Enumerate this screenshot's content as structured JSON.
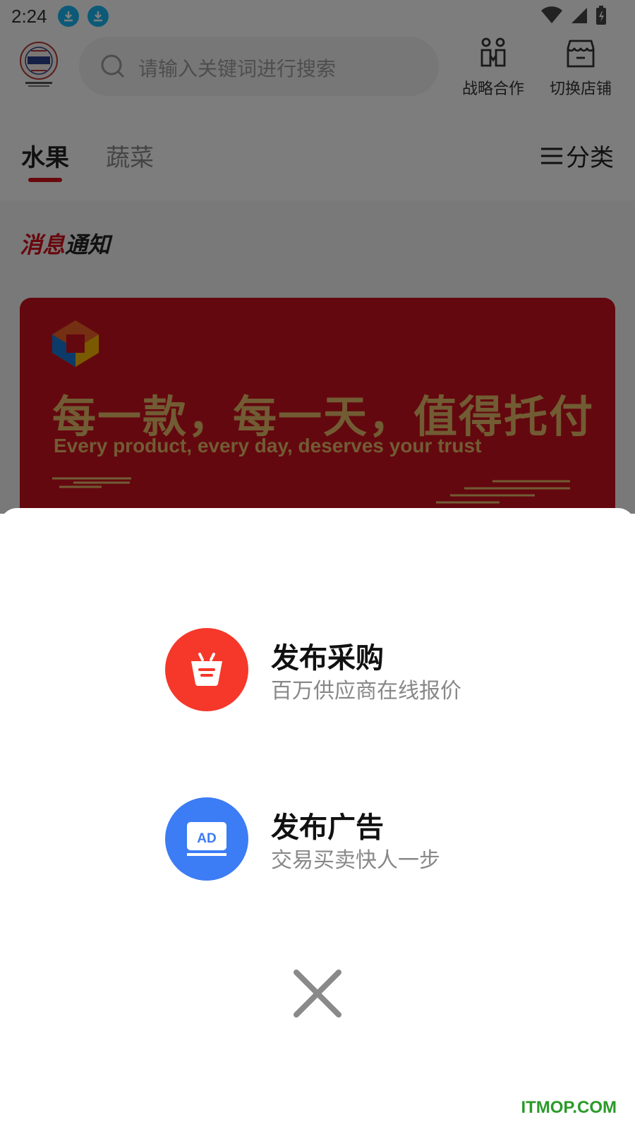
{
  "status_bar": {
    "time": "2:24"
  },
  "header": {
    "search_placeholder": "请输入关键词进行搜索",
    "partner_label": "战略合作",
    "switch_store_label": "切换店铺"
  },
  "tabs": [
    {
      "label": "水果"
    },
    {
      "label": "蔬菜"
    }
  ],
  "category_label": "分类",
  "notice": {
    "title_red": "消息",
    "title_dark": "通知"
  },
  "banner": {
    "headline": "每一款，每一天，值得托付",
    "subline": "Every product, every day, deserves your trust"
  },
  "sheet": {
    "actions": [
      {
        "title": "发布采购",
        "subtitle": "百万供应商在线报价",
        "icon": "shopping-basket-icon",
        "color": "#f5382a"
      },
      {
        "title": "发布广告",
        "subtitle": "交易买卖快人一步",
        "icon": "ad-icon",
        "color": "#3c7cf4"
      }
    ],
    "close_icon": "close-icon"
  },
  "watermark": "ITMOP.COM"
}
